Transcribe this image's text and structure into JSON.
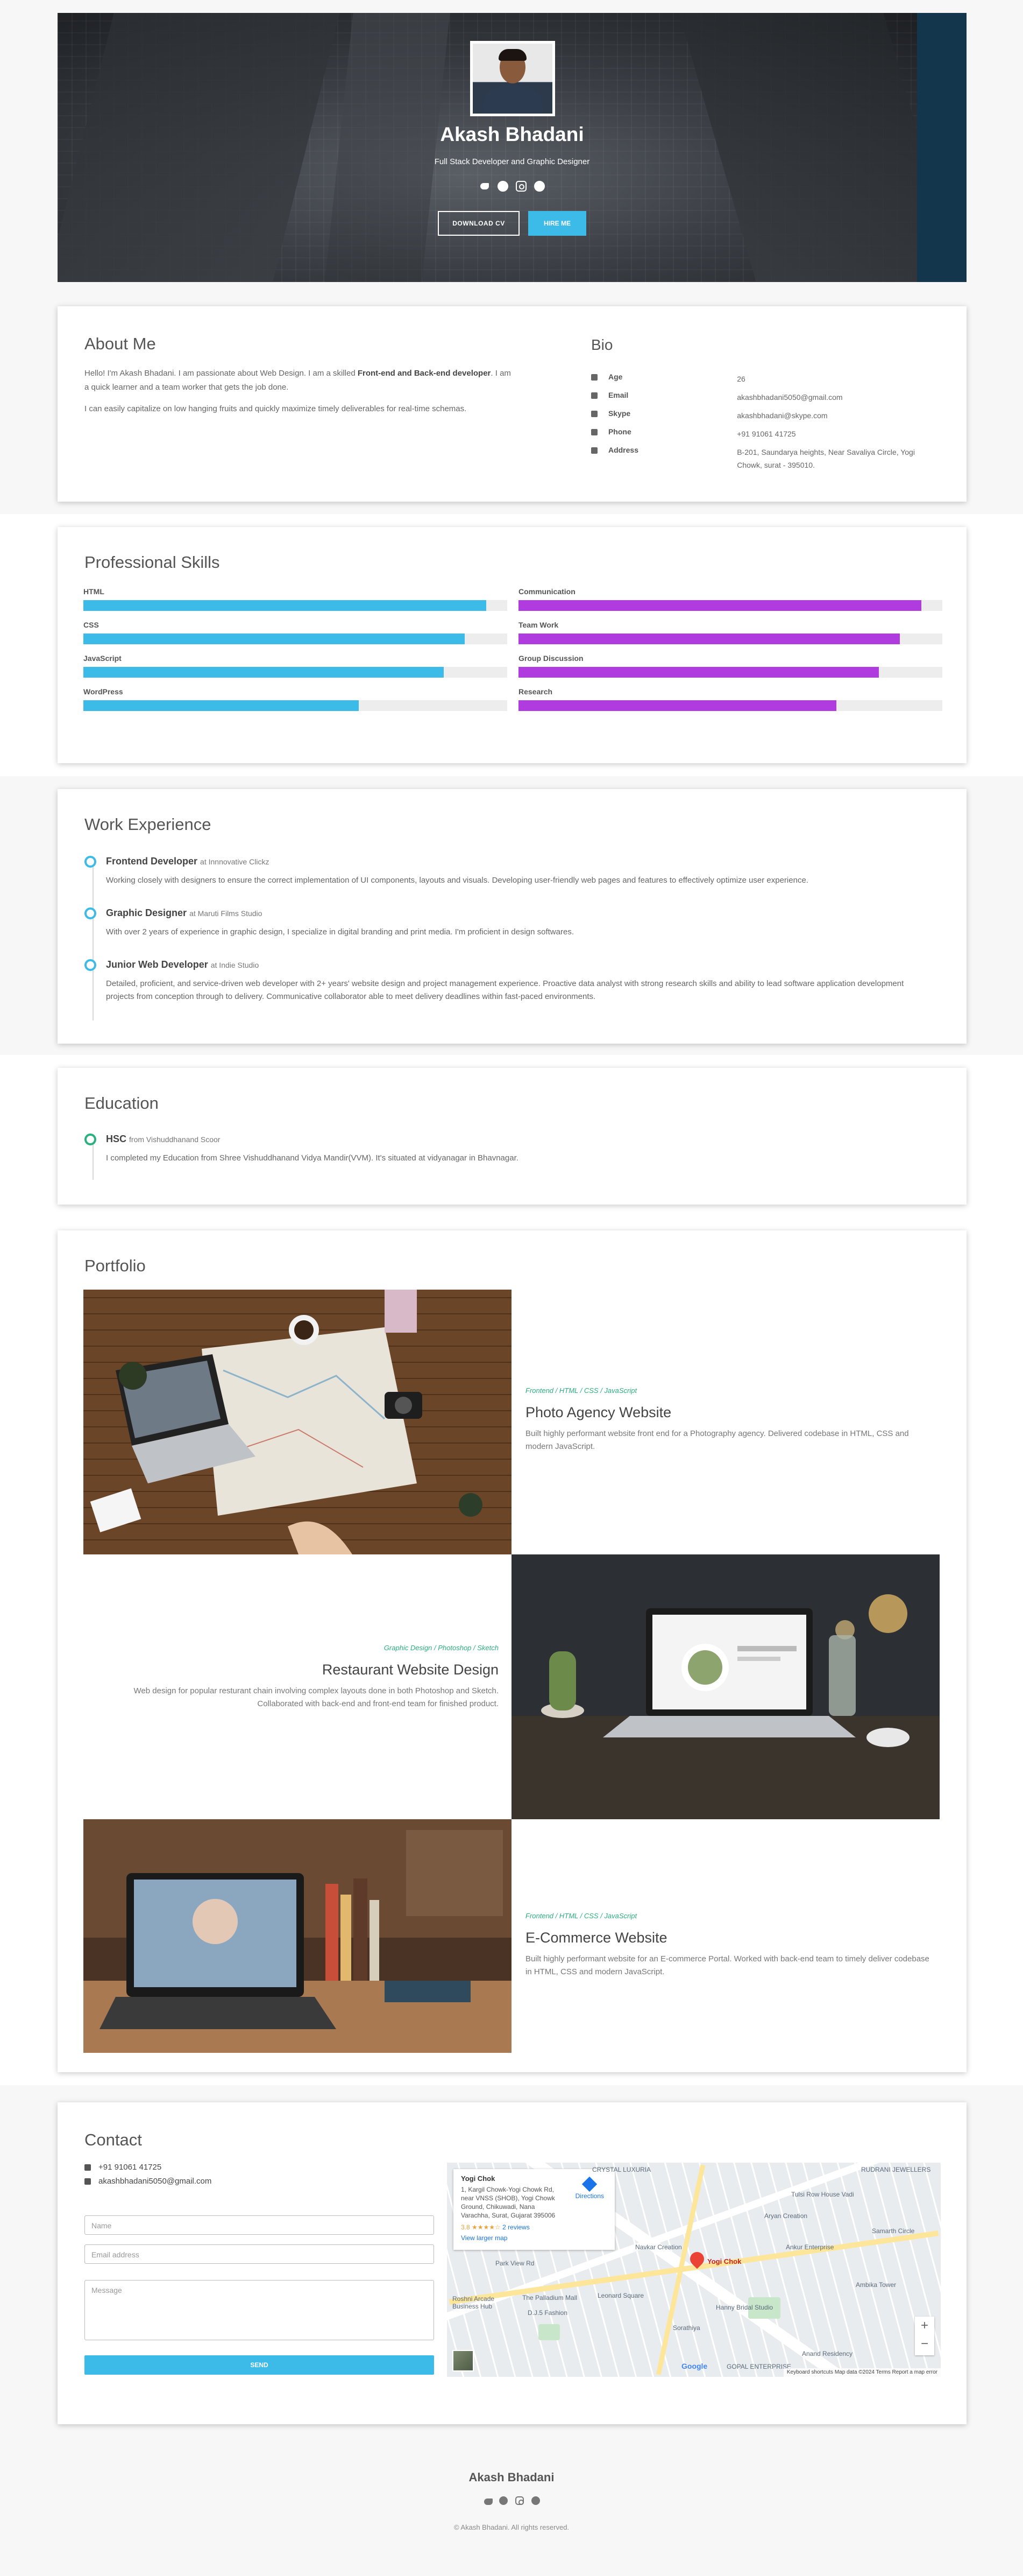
{
  "header": {
    "name": "Akash Bhadani",
    "role": "Full Stack Developer and Graphic Designer",
    "socials": [
      "twitter-icon",
      "facebook-icon",
      "instagram-icon",
      "github-icon"
    ],
    "download_cv": "DOWNLOAD CV",
    "hire_me": "HIRE ME"
  },
  "about": {
    "title": "About Me",
    "p1_a": "Hello! I'm Akash Bhadani. I am passionate about Web Design. I am a skilled ",
    "p1_b": "Front-end and Back-end developer",
    "p1_c": ". I am a quick learner and a team worker that gets the job done.",
    "p2": "I can easily capitalize on low hanging fruits and quickly maximize timely deliverables for real-time schemas.",
    "bio_title": "Bio",
    "bio": [
      {
        "icon": "calendar-icon",
        "key": "Age",
        "value": "26"
      },
      {
        "icon": "email-icon",
        "key": "Email",
        "value": "akashbhadani5050@gmail.com"
      },
      {
        "icon": "skype-icon",
        "key": "Skype",
        "value": "akashbhadani@skype.com"
      },
      {
        "icon": "phone-icon",
        "key": "Phone",
        "value": "+91 91061 41725"
      },
      {
        "icon": "location-icon",
        "key": "Address",
        "value": "B-201, Saundarya heights, Near Savaliya Circle, Yogi Chowk, surat - 395010."
      }
    ]
  },
  "skills": {
    "title": "Professional Skills",
    "left": [
      {
        "label": "HTML",
        "level": 0.95
      },
      {
        "label": "CSS",
        "level": 0.9
      },
      {
        "label": "JavaScript",
        "level": 0.85
      },
      {
        "label": "WordPress",
        "level": 0.65
      }
    ],
    "right": [
      {
        "label": "Communication",
        "level": 0.95
      },
      {
        "label": "Team Work",
        "level": 0.9
      },
      {
        "label": "Group Discussion",
        "level": 0.85
      },
      {
        "label": "Research",
        "level": 0.75
      }
    ],
    "colors": {
      "left": "#3dbbe8",
      "right": "#b03bdf"
    }
  },
  "experience": {
    "title": "Work Experience",
    "items": [
      {
        "role": "Frontend Developer",
        "at": "at Innnovative Clickz",
        "desc": "Working closely with designers to ensure the correct implementation of UI components, layouts and visuals. Developing user-friendly web pages and features to effectively optimize user experience."
      },
      {
        "role": "Graphic Designer",
        "at": "at Maruti Films Studio",
        "desc": "With over 2 years of experience in graphic design, I specialize in digital branding and print media. I'm proficient in design softwares."
      },
      {
        "role": "Junior Web Developer",
        "at": "at Indie Studio",
        "desc": "Detailed, proficient, and service-driven web developer with 2+ years' website design and project management experience. Proactive data analyst with strong research skills and ability to lead software application development projects from conception through to delivery. Communicative collaborator able to meet delivery deadlines within fast-paced environments."
      }
    ]
  },
  "education": {
    "title": "Education",
    "items": [
      {
        "role": "HSC",
        "at": "from Vishuddhanand Scoor",
        "desc": "I completed my Education from Shree Vishuddhanand Vidya Mandir(VVM). It's situated at vidyanagar in Bhavnagar."
      }
    ]
  },
  "portfolio": {
    "title": "Portfolio",
    "items": [
      {
        "tags": "Frontend / HTML / CSS / JavaScript",
        "title": "Photo Agency Website",
        "desc": "Built highly performant website front end for a Photography agency. Delivered codebase in HTML, CSS and modern JavaScript."
      },
      {
        "tags": "Graphic Design / Photoshop / Sketch",
        "title": "Restaurant Website Design",
        "desc": "Web design for popular resturant chain involving complex layouts done in both Photoshop and Sketch. Collaborated with back-end and front-end team for finished product."
      },
      {
        "tags": "Frontend / HTML / CSS / JavaScript",
        "title": "E-Commerce Website",
        "desc": "Built highly performant website for an E-commerce Portal. Worked with back-end team to timely deliver codebase in HTML, CSS and modern JavaScript."
      }
    ]
  },
  "contact": {
    "title": "Contact",
    "phone": "+91 91061 41725",
    "email": "akashbhadani5050@gmail.com",
    "name_placeholder": "Name",
    "email_placeholder": "Email address",
    "message_placeholder": "Message",
    "send": "SEND",
    "map": {
      "place": "Yogi Chok",
      "address": "1, Kargil Chowk-Yogi Chowk Rd, near VNSS (SHOB), Yogi Chowk Ground, Chikuwadi, Nana Varachha, Surat, Gujarat 395006",
      "directions": "Directions",
      "rating": "3.8 ★★★★☆",
      "reviews": "2 reviews",
      "larger": "View larger map",
      "pin_label": "Yogi Chok",
      "labels": [
        "CRYSTAL LUXURIA",
        "RUDRANI JEWELLERS",
        "Tulsi Row House Vadi",
        "Aryan Creation",
        "Samarth Circle",
        "Park View Rd",
        "Navkar Creation",
        "The Palladium Mall",
        "D.J.5 Fashion",
        "Leonard Square",
        "Hanny Bridal Studio",
        "Ankur Enterprise",
        "Ambika Tower",
        "Sorathiya",
        "Anand Residency",
        "GOPAL ENTERPRISE",
        "Roshni Arcade Business Hub"
      ],
      "google": "Google",
      "attribution": "Keyboard shortcuts   Map data ©2024   Terms   Report a map error"
    }
  },
  "footer": {
    "name": "Akash Bhadani",
    "copyright": "© Akash Bhadani. All rights reserved."
  }
}
